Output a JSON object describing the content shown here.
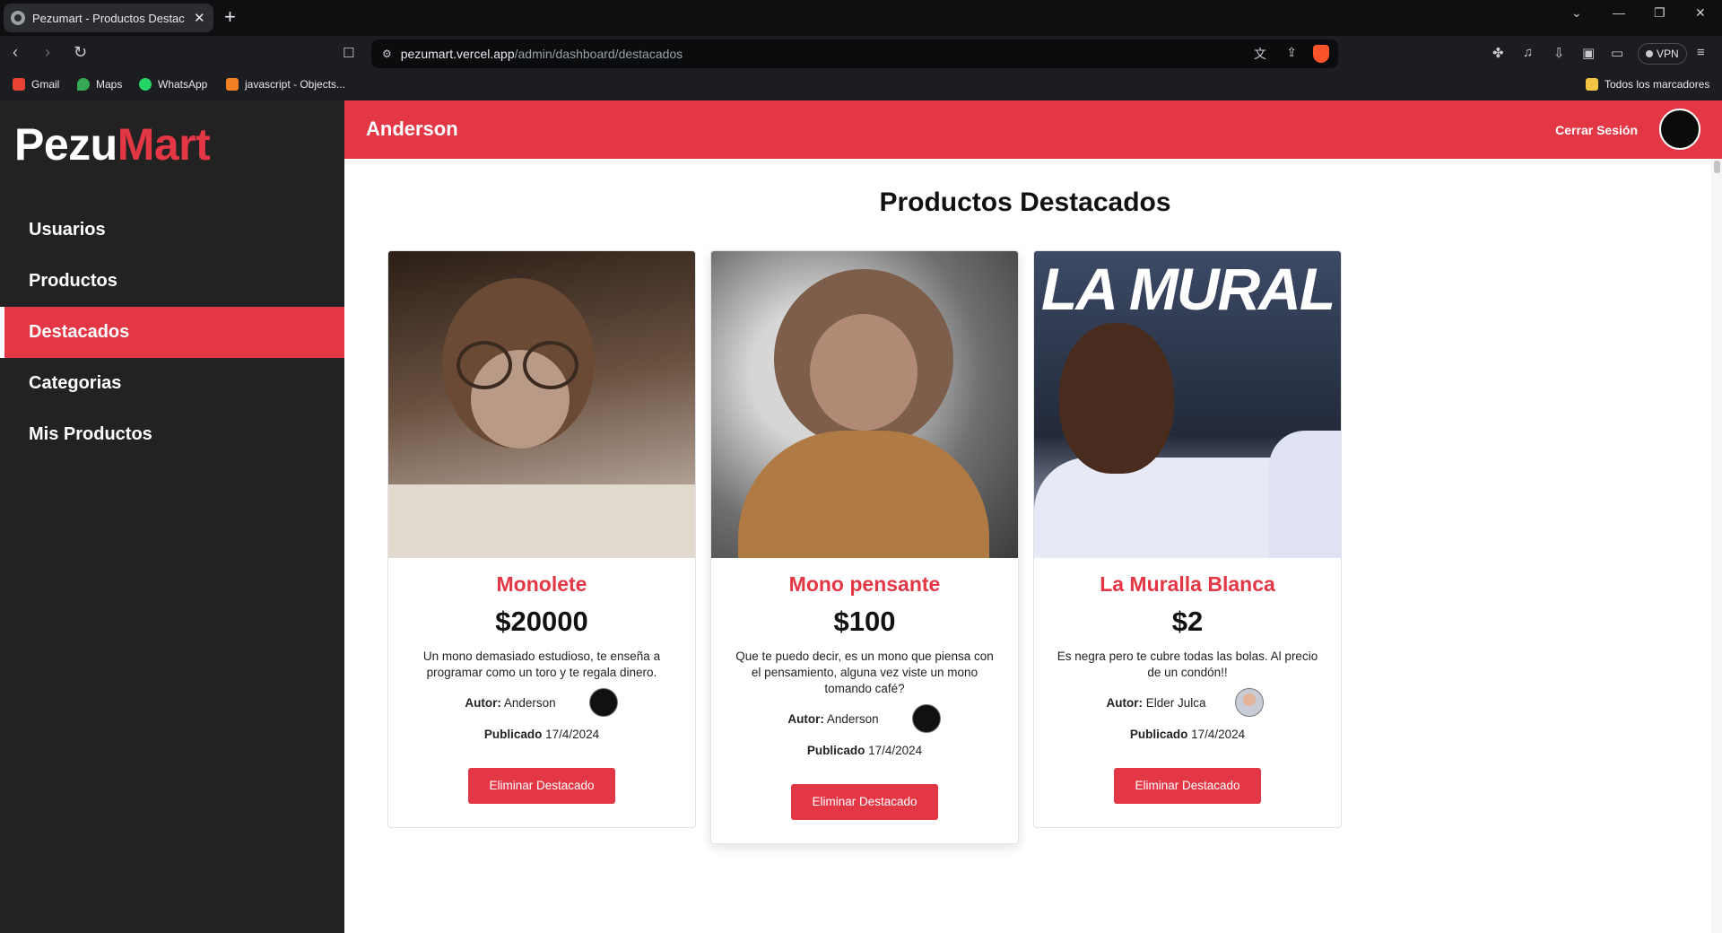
{
  "browser": {
    "tab_title": "Pezumart - Productos Destacados",
    "tab_close": "✕",
    "new_tab": "+",
    "url_host": "pezumart.vercel.app",
    "url_path": "/admin/dashboard/destacados",
    "vpn_label": "VPN",
    "bookmarks": [
      {
        "label": "Gmail",
        "icon_color": "#ea4335"
      },
      {
        "label": "Maps",
        "icon_color": "#34a853"
      },
      {
        "label": "WhatsApp",
        "icon_color": "#25d366"
      },
      {
        "label": "javascript - Objects...",
        "icon_color": "#f48024"
      }
    ],
    "all_bookmarks": "Todos los marcadores"
  },
  "sidebar": {
    "logo_part1": "Pezu",
    "logo_part2": "Mart",
    "items": [
      {
        "label": "Usuarios",
        "active": false
      },
      {
        "label": "Productos",
        "active": false
      },
      {
        "label": "Destacados",
        "active": true
      },
      {
        "label": "Categorias",
        "active": false
      },
      {
        "label": "Mis Productos",
        "active": false
      }
    ]
  },
  "header": {
    "username": "Anderson",
    "logout_label": "Cerrar Sesión"
  },
  "main": {
    "title": "Productos Destacados",
    "products": [
      {
        "name": "Monolete",
        "price": "$20000",
        "description": "Un mono demasiado estudioso, te enseña a programar como un toro y te regala dinero.",
        "author_label": "Autor:",
        "author": "Anderson",
        "published_label": "Publicado",
        "published": "17/4/2024",
        "button": "Eliminar Destacado"
      },
      {
        "name": "Mono pensante",
        "price": "$100",
        "description": "Que te puedo decir, es un mono que piensa con el pensamiento, alguna vez viste un mono tomando café?",
        "author_label": "Autor:",
        "author": "Anderson",
        "published_label": "Publicado",
        "published": "17/4/2024",
        "button": "Eliminar Destacado"
      },
      {
        "name": "La Muralla Blanca",
        "price": "$2",
        "description": "Es negra pero te cubre todas las bolas. Al precio de un condón!!",
        "author_label": "Autor:",
        "author": "Elder Julca",
        "published_label": "Publicado",
        "published": "17/4/2024",
        "button": "Eliminar Destacado",
        "image_text": "LA MURAL"
      }
    ]
  },
  "colors": {
    "accent": "#e43745",
    "sidebar_bg": "#222222"
  }
}
